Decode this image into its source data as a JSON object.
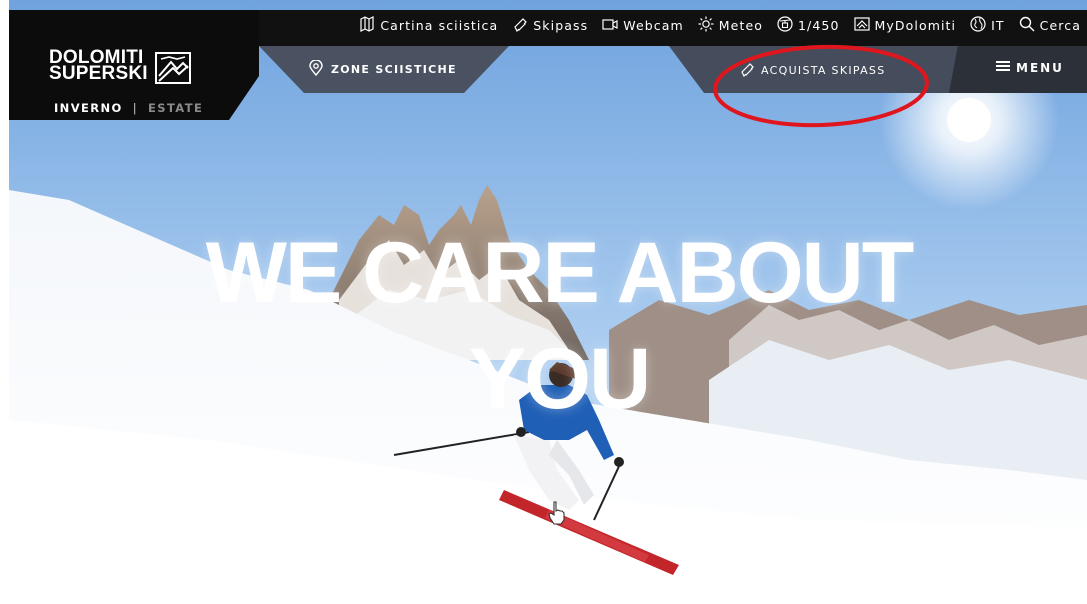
{
  "utility_nav": [
    {
      "icon": "map-icon",
      "label": "Cartina sciistica"
    },
    {
      "icon": "ticket-icon",
      "label": "Skipass"
    },
    {
      "icon": "webcam-icon",
      "label": "Webcam"
    },
    {
      "icon": "sun-icon",
      "label": "Meteo"
    },
    {
      "icon": "lift-icon",
      "label": "1/450"
    },
    {
      "icon": "mydolomiti-icon",
      "label": "MyDolomiti"
    },
    {
      "icon": "globe-icon",
      "label": "IT"
    },
    {
      "icon": "search-icon",
      "label": "Cerca"
    }
  ],
  "logo": {
    "line1": "DOLOMITI",
    "line2": "SUPERSKI"
  },
  "season": {
    "active": "INVERNO",
    "separator": "|",
    "inactive": "ESTATE"
  },
  "nav": {
    "zones": "ZONE SCIISTICHE",
    "buy": "ACQUISTA SKIPASS",
    "menu": "MENU"
  },
  "hero": {
    "line1": "WE CARE ABOUT",
    "line2": "YOU"
  },
  "colors": {
    "annotation": "#e0161e",
    "bar": "#111111",
    "band": "#4a5262"
  }
}
